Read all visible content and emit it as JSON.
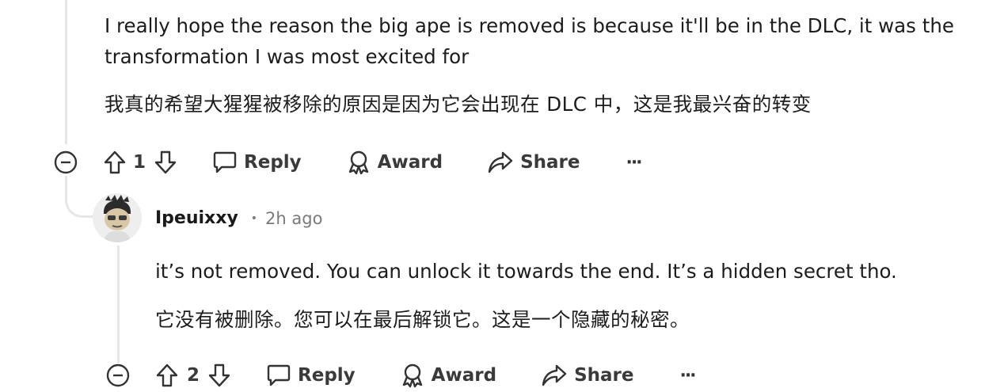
{
  "parent_comment": {
    "body_en": [
      "I really hope the reason the big ape is removed is because it'll be in the DLC, it was the",
      "transformation I was most excited for"
    ],
    "body_zh": "我真的希望大猩猩被移除的原因是因为它会出现在 DLC 中，这是我最兴奋的转变",
    "actions": {
      "vote_count": "1",
      "reply_label": "Reply",
      "award_label": "Award",
      "share_label": "Share",
      "more_label": "···"
    }
  },
  "reply_comment": {
    "username": "Ipeuixxy",
    "separator": "•",
    "timestamp": "2h ago",
    "body_en": "it’s not removed. You can unlock it towards the end. It’s a hidden secret tho.",
    "body_zh": "它没有被删除。您可以在最后解锁它。这是一个隐藏的秘密。",
    "actions": {
      "vote_count": "2",
      "reply_label": "Reply",
      "award_label": "Award",
      "share_label": "Share",
      "more_label": "···"
    }
  },
  "icons": [
    "collapse-icon",
    "upvote-icon",
    "downvote-icon",
    "comment-icon",
    "award-icon",
    "share-icon",
    "more-icon"
  ]
}
